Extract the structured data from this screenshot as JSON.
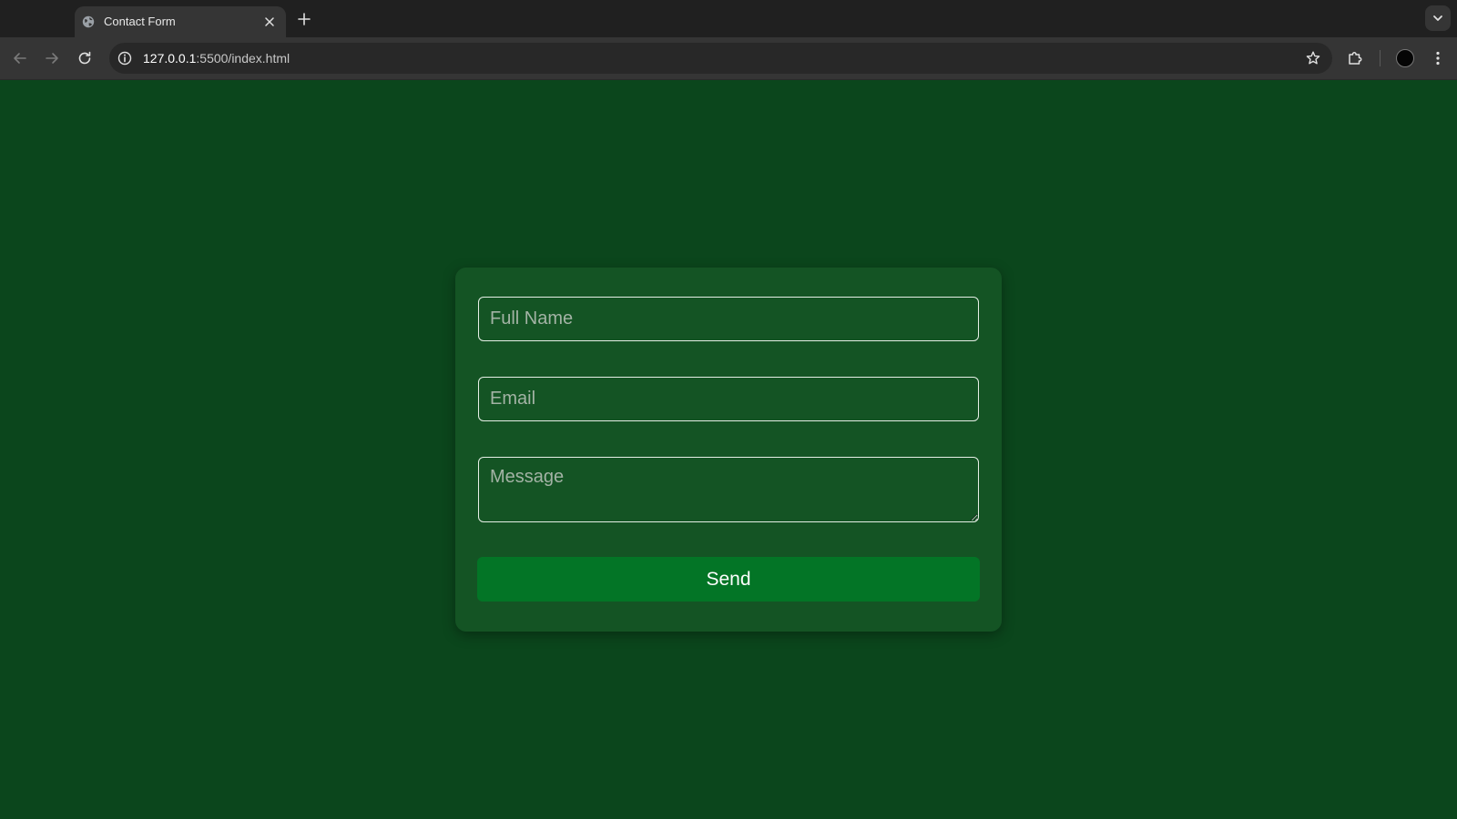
{
  "browser": {
    "tab": {
      "title": "Contact Form",
      "favicon": "globe-icon",
      "close_icon": "close-icon"
    },
    "new_tab_icon": "plus-icon",
    "tab_search_icon": "chevron-down-icon",
    "toolbar": {
      "back_icon": "arrow-left-icon",
      "forward_icon": "arrow-right-icon",
      "reload_icon": "reload-icon",
      "site_info_icon": "info-icon",
      "url_host": "127.0.0.1",
      "url_path": ":5500/index.html",
      "bookmark_icon": "star-icon",
      "extensions_icon": "puzzle-icon",
      "menu_icon": "kebab-menu-icon"
    }
  },
  "form": {
    "name_placeholder": "Full Name",
    "name_value": "",
    "email_placeholder": "Email",
    "email_value": "",
    "message_placeholder": "Message",
    "message_value": "",
    "send_label": "Send"
  },
  "colors": {
    "page_background": "#0b461c",
    "card_background": "#145424",
    "button_background": "#037526",
    "field_border": "#e6efe6"
  }
}
